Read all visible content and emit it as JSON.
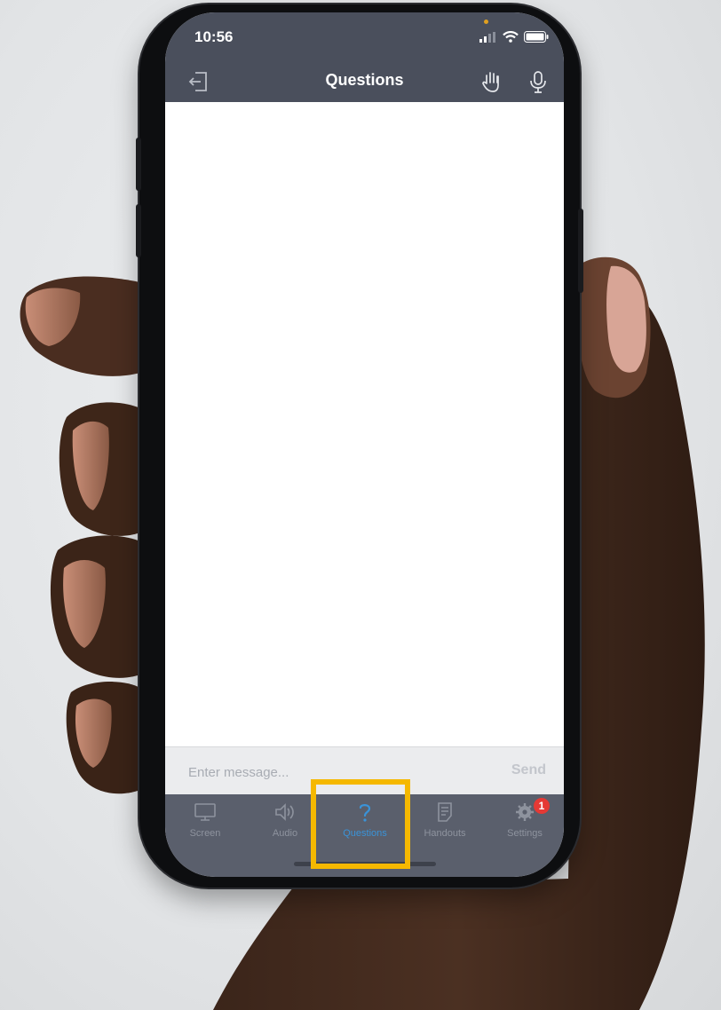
{
  "status_bar": {
    "time": "10:56"
  },
  "nav": {
    "title": "Questions",
    "left_icon": "exit-icon",
    "right_icons": [
      "raise-hand-icon",
      "microphone-icon"
    ]
  },
  "composer": {
    "placeholder": "Enter message...",
    "send_label": "Send"
  },
  "tabs": [
    {
      "label": "Screen",
      "icon": "monitor-icon",
      "active": false
    },
    {
      "label": "Audio",
      "icon": "speaker-icon",
      "active": false
    },
    {
      "label": "Questions",
      "icon": "question-icon",
      "active": true
    },
    {
      "label": "Handouts",
      "icon": "document-icon",
      "active": false
    },
    {
      "label": "Settings",
      "icon": "gear-icon",
      "active": false,
      "badge": "1"
    }
  ],
  "colors": {
    "header": "#4a4f5c",
    "tabbar": "#5a5f6c",
    "active_tab": "#3a93d8",
    "badge": "#e53935",
    "highlight": "#f5b800"
  }
}
